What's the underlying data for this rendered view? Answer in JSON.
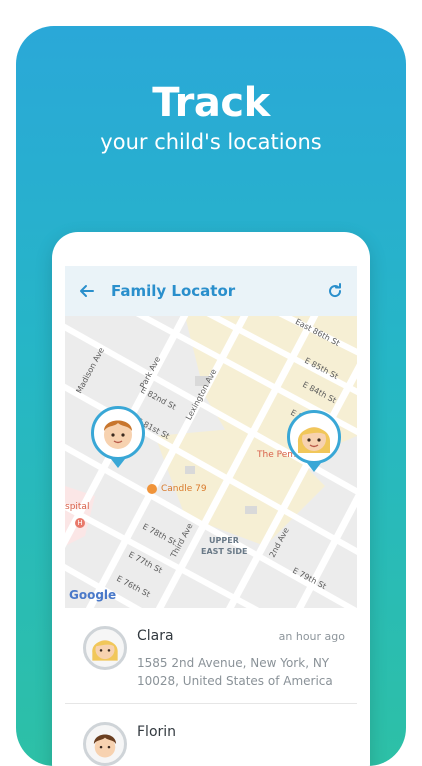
{
  "promo": {
    "headline": "Track",
    "subheadline": "your child's locations"
  },
  "appbar": {
    "back_icon": "arrow-left-icon",
    "title": "Family Locator",
    "refresh_icon": "refresh-icon"
  },
  "map": {
    "labels": {
      "east_86th": "East 86th St",
      "e_85th": "E 85th St",
      "e_84th": "E 84th St",
      "e_83rd": "E 83rd St",
      "madison": "Madison Ave",
      "park": "Park Ave",
      "e_82nd": "E 82nd St",
      "e_81st": "E 81st St",
      "lexington": "Lexington Ave",
      "the_pem": "The Pem",
      "e_80th_right": "E 80th St",
      "hospital": "spital",
      "candle": "Candle 79",
      "e_78th": "E 78th St",
      "third_ave": "Third Ave",
      "upper_east_1": "UPPER",
      "upper_east_2": "EAST SIDE",
      "second_ave": "2nd Ave",
      "e_77th": "E 77th St",
      "e_76th": "E 76th St",
      "e_79th": "E 79th St",
      "google": "Google"
    }
  },
  "contacts": [
    {
      "name": "Clara",
      "time": "an hour ago",
      "address": "1585 2nd Avenue, New York, NY 10028, United States of America"
    },
    {
      "name": "Florin",
      "time": "",
      "address": ""
    }
  ],
  "colors": {
    "accent": "#2a8fcc",
    "pin_border": "#39a7d6",
    "gradient_top": "#2aa8d8",
    "gradient_bottom": "#2dc0a6"
  }
}
